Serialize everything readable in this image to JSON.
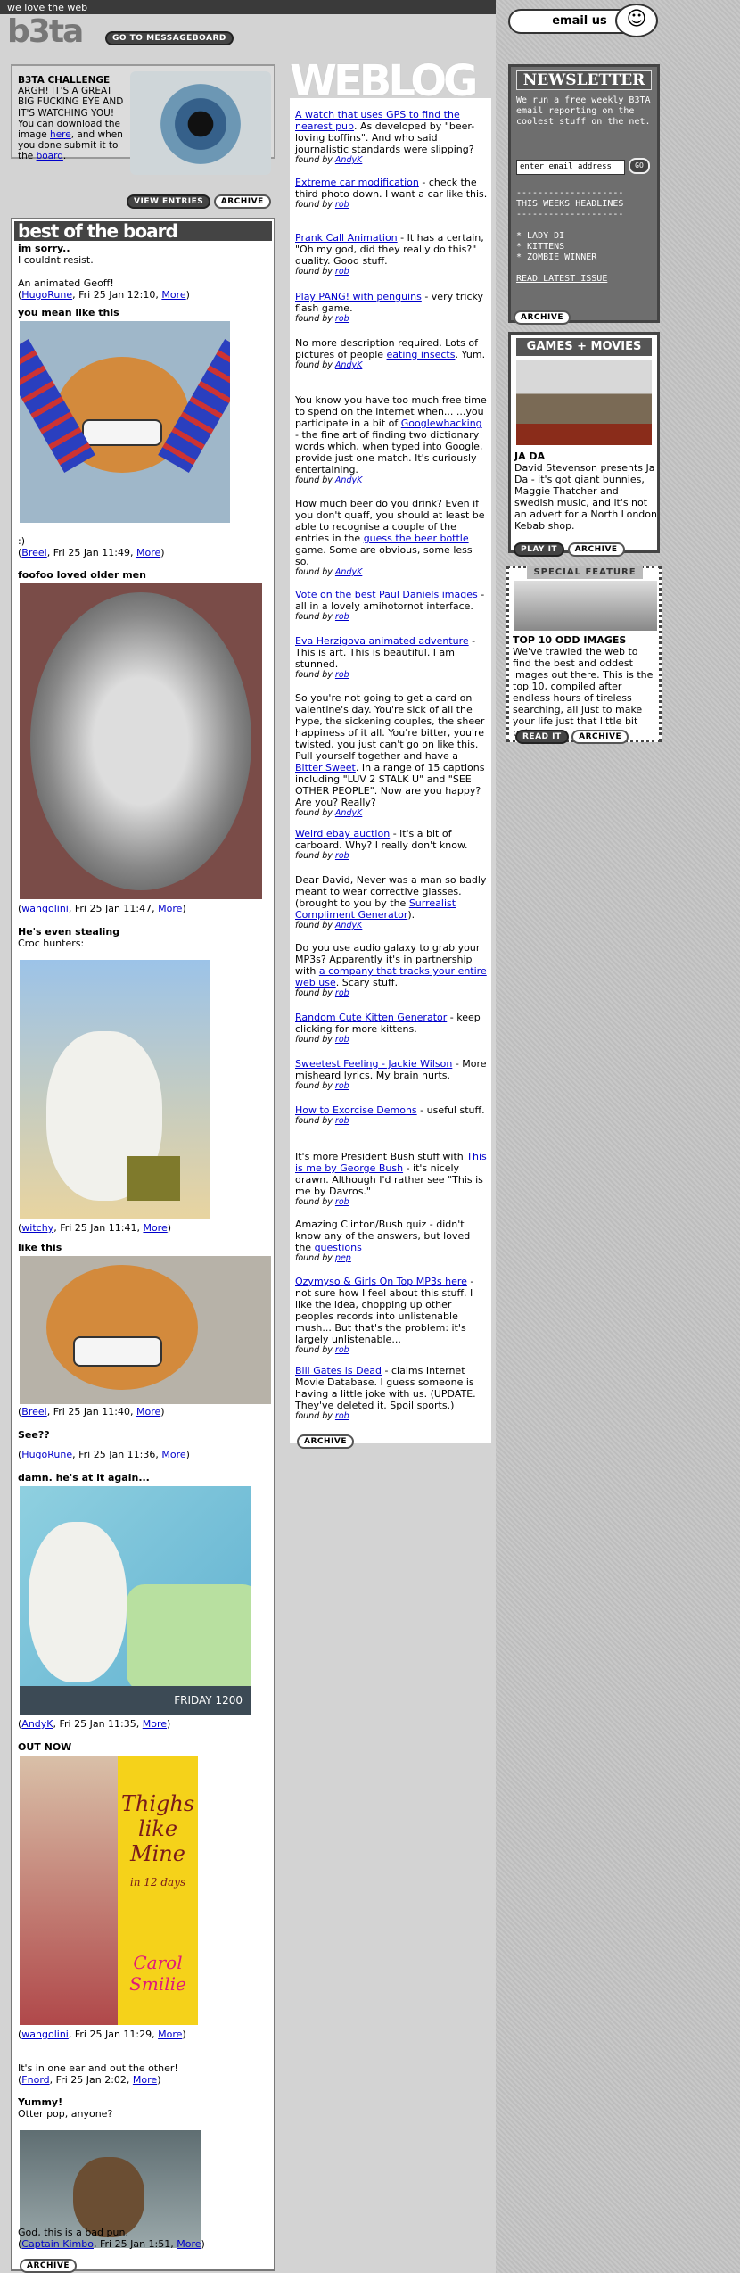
{
  "header": {
    "tagline": "we love the web",
    "logo": "b3ta",
    "messageboard_btn": "GO TO MESSAGEBOARD",
    "email_btn": "email us"
  },
  "challenge": {
    "title": "B3TA CHALLENGE",
    "text1": "ARGH! IT'S A GREAT BIG FUCKING EYE AND IT'S WATCHING YOU! You can download the image ",
    "link1": "here",
    "text2": ", and when you done submit it to the ",
    "link2": "board",
    "text3": ".",
    "view_entries": "VIEW ENTRIES",
    "archive": "ARCHIVE"
  },
  "board": {
    "title": "best of the board",
    "archive": "ARCHIVE",
    "posts": [
      {
        "title": "im sorry..",
        "body": "I couldnt resist.\n\nAn animated Geoff!",
        "author": "HugoRune",
        "date": "Fri 25 Jan 12:10",
        "more": "More"
      },
      {
        "title": "you mean like this",
        "body": ":)",
        "author": "Breel",
        "date": "Fri 25 Jan 11:49",
        "more": "More"
      },
      {
        "title": "foofoo loved older men",
        "body": "",
        "author": "wangolini",
        "date": "Fri 25 Jan 11:47",
        "more": "More"
      },
      {
        "title": "He's even stealing",
        "body": "Croc hunters:",
        "author": "witchy",
        "date": "Fri 25 Jan 11:41",
        "more": "More"
      },
      {
        "title": "like this",
        "body": "",
        "author": "Breel",
        "date": "Fri 25 Jan 11:40",
        "more": "More"
      },
      {
        "title": "See??",
        "body": "",
        "author": "HugoRune",
        "date": "Fri 25 Jan 11:36",
        "more": "More"
      },
      {
        "title": "damn. he's at it again...",
        "body": "",
        "author": "AndyK",
        "date": "Fri 25 Jan 11:35",
        "more": "More"
      },
      {
        "title": "OUT NOW",
        "body": "",
        "author": "wangolini",
        "date": "Fri 25 Jan 11:29",
        "more": "More"
      },
      {
        "title": "",
        "body": "It's in one ear and out the other!",
        "author": "Fnord",
        "date": "Fri 25 Jan 2:02",
        "more": "More"
      },
      {
        "title": "Yummy!",
        "body": "Otter pop, anyone?",
        "author": "",
        "date": "",
        "more": ""
      },
      {
        "title": "",
        "body": "God, this is a bad pun.",
        "author": "Captain Kimbo",
        "date": "Fri 25 Jan 1:51",
        "more": "More"
      }
    ],
    "img_friday": "FRIDAY 1200",
    "img_thighs_1": "Thighs",
    "img_thighs_2": "like",
    "img_thighs_3": "Mine",
    "img_thighs_4": "in 12 days",
    "img_thighs_5": "Carol",
    "img_thighs_6": "Smilie"
  },
  "weblog": {
    "title": "WEBLOG",
    "archive": "ARCHIVE",
    "found_prefix": "found by ",
    "entries": [
      {
        "pre": "",
        "link": "A watch that uses GPS to find the nearest pub",
        "post": ". As developed by \"beer-loving boffins\". And who said journalistic standards were slipping?",
        "by": "AndyK"
      },
      {
        "pre": "",
        "link": "Extreme car modification",
        "post": " - check the third photo down. I want a car like this.",
        "by": "rob"
      },
      {
        "pre": "",
        "link": "Prank Call Animation",
        "post": " - It has a certain, \"Oh my god, did they really do this?\" quality. Good stuff.",
        "by": "rob"
      },
      {
        "pre": "",
        "link": "Play PANG! with penguins",
        "post": " - very tricky flash game.",
        "by": "rob"
      },
      {
        "pre": "No more description required. Lots of pictures of people ",
        "link": "eating insects",
        "post": ". Yum.",
        "by": "AndyK"
      },
      {
        "pre": "You know you have too much free time to spend on the internet when... ...you participate in a bit of ",
        "link": "Googlewhacking",
        "post": " - the fine art of finding two dictionary words which, when typed into Google, provide just one match. It's curiously entertaining.",
        "by": "AndyK"
      },
      {
        "pre": "How much beer do you drink? Even if you don't quaff, you should at least be able to recognise a couple of the entries in the ",
        "link": "guess the beer bottle",
        "post": " game. Some are obvious, some less so.",
        "by": "AndyK"
      },
      {
        "pre": "",
        "link": "Vote on the best Paul Daniels images",
        "post": " - all in a lovely amihotornot interface.",
        "by": "rob"
      },
      {
        "pre": "",
        "link": "Eva Herzigova animated adventure",
        "post": " - This is art. This is beautiful. I am stunned.",
        "by": "rob"
      },
      {
        "pre": "So you're not going to get a card on valentine's day. You're sick of all the hype, the sickening couples, the sheer happiness of it all. You're bitter, you're twisted, you just can't go on like this. Pull yourself together and have a ",
        "link": "Bitter Sweet",
        "post": ". In a range of 15 captions including \"LUV 2 STALK U\" and \"SEE OTHER PEOPLE\". Now are you happy? Are you? Really?",
        "by": "AndyK"
      },
      {
        "pre": "",
        "link": "Weird ebay auction",
        "post": " - it's a bit of carboard. Why? I really don't know.",
        "by": "rob"
      },
      {
        "pre": "Dear David, Never was a man so badly meant to wear corrective glasses. (brought to you by the ",
        "link": "Surrealist Compliment Generator",
        "post": ").",
        "by": "AndyK"
      },
      {
        "pre": "Do you use audio galaxy to grab your MP3s? Apparently it's in partnership with ",
        "link": "a company that tracks your entire web use",
        "post": ". Scary stuff.",
        "by": "rob"
      },
      {
        "pre": "",
        "link": "Random Cute Kitten Generator",
        "post": " - keep clicking for more kittens.",
        "by": "rob"
      },
      {
        "pre": "",
        "link": "Sweetest Feeling - Jackie Wilson",
        "post": " - More misheard lyrics. My brain hurts.",
        "by": "rob"
      },
      {
        "pre": "",
        "link": "How to Exorcise Demons",
        "post": " - useful stuff.",
        "by": "rob"
      },
      {
        "pre": "It's more President Bush stuff with ",
        "link": "This is me by George Bush",
        "post": " - it's nicely drawn. Although I'd rather see \"This is me by Davros.\"",
        "by": "rob"
      },
      {
        "pre": "Amazing Clinton/Bush quiz - didn't know any of the answers, but loved the ",
        "link": "questions",
        "post": "",
        "by": "pep"
      },
      {
        "pre": "",
        "link": "Ozymyso & Girls On Top MP3s here",
        "post": " - not sure how I feel about this stuff. I like the idea, chopping up other peoples records into unlistenable mush... But that's the problem: it's largely unlistenable...",
        "by": "rob"
      },
      {
        "pre": "",
        "link": "Bill Gates is Dead",
        "post": " - claims Internet Movie Database. I guess someone is having a little joke with us. (UPDATE. They've deleted it. Spoil sports.)",
        "by": "rob"
      }
    ]
  },
  "newsletter": {
    "title": "NEWSLETTER",
    "intro": "We run a free weekly B3TA email reporting on the coolest stuff on the net.",
    "input_value": "enter email address",
    "go": "GO",
    "divider": "--------------------",
    "headlines_title": "THIS WEEKS HEADLINES",
    "headlines": [
      "* LADY DI",
      "* KITTENS",
      "* ZOMBIE WINNER"
    ],
    "read_latest": "READ LATEST ISSUE",
    "archive": "ARCHIVE"
  },
  "games": {
    "title": "GAMES + MOVIES",
    "item_title": "JA DA",
    "desc": "David Stevenson presents Ja Da - it's got giant bunnies, Maggie Thatcher and swedish music, and it's not an advert for a North London Kebab shop.",
    "play": "PLAY IT",
    "archive": "ARCHIVE"
  },
  "special": {
    "label": "SPECIAL FEATURE",
    "title": "TOP 10 ODD IMAGES",
    "desc": "We've trawled the web to find the best and oddest images out there. This is the top 10, compiled after endless hours of tireless searching, all just to make your life just that little bit better.",
    "read": "READ IT",
    "archive": "ARCHIVE"
  }
}
